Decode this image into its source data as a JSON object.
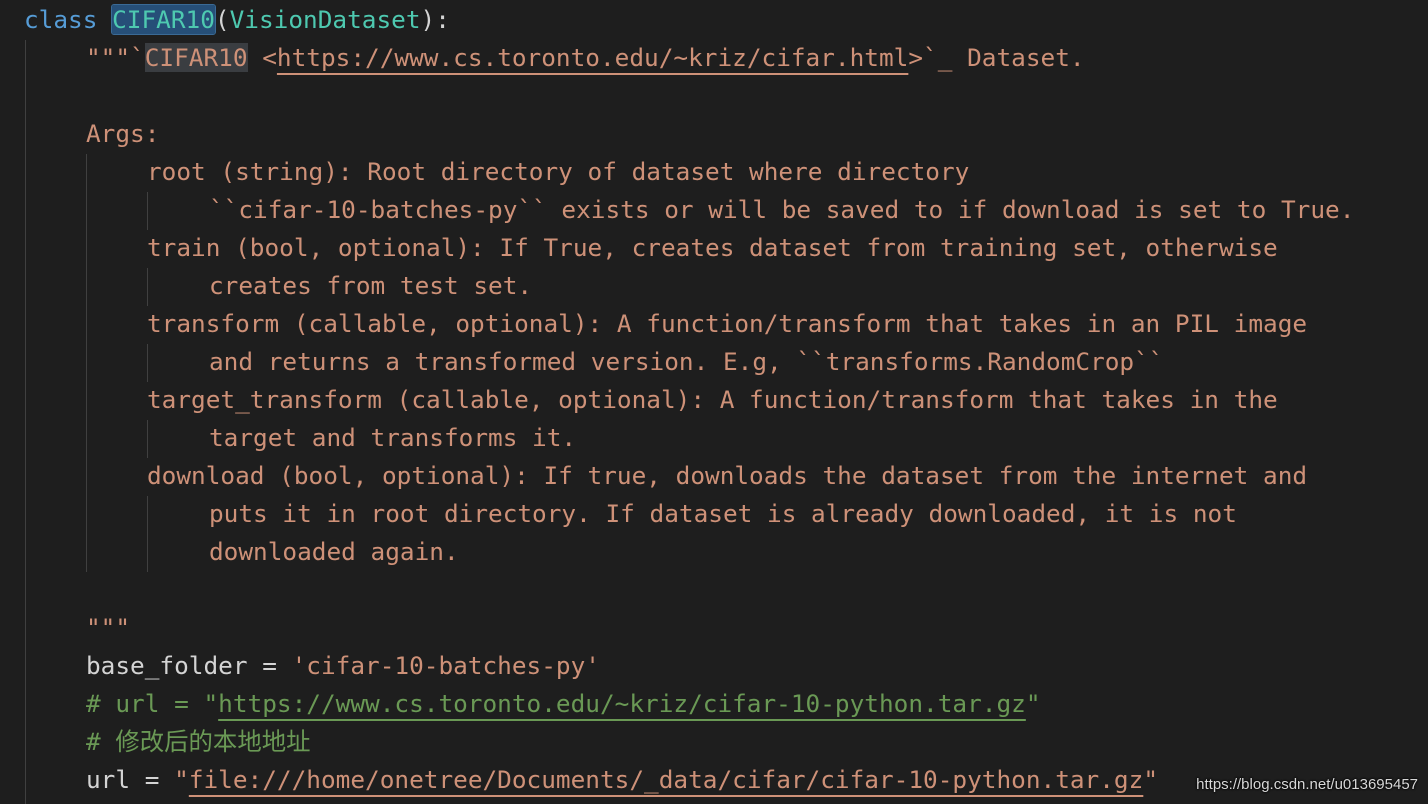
{
  "editor": {
    "class_keyword": "class",
    "class_name": "CIFAR10",
    "paren_open": "(",
    "base_class": "VisionDataset",
    "paren_close": "):",
    "doc_open": "\"\"\"`",
    "doc_title": "CIFAR10",
    "doc_space": " <",
    "doc_link": "https://www.cs.toronto.edu/~kriz/cifar.html",
    "doc_tail": ">`_ Dataset.",
    "args_header": "Args:",
    "arg_root_1": "root (string): Root directory of dataset where directory",
    "arg_root_2": "``cifar-10-batches-py`` exists or will be saved to if download is set to True.",
    "arg_train_1": "train (bool, optional): If True, creates dataset from training set, otherwise",
    "arg_train_2": "creates from test set.",
    "arg_transform_1": "transform (callable, optional): A function/transform that takes in an PIL image",
    "arg_transform_2": "and returns a transformed version. E.g, ``transforms.RandomCrop``",
    "arg_target_1": "target_transform (callable, optional): A function/transform that takes in the",
    "arg_target_2": "target and transforms it.",
    "arg_download_1": "download (bool, optional): If true, downloads the dataset from the internet and",
    "arg_download_2": "puts it in root directory. If dataset is already downloaded, it is not",
    "arg_download_3": "downloaded again.",
    "doc_close": "\"\"\"",
    "base_folder_var": "base_folder",
    "assign": " = ",
    "base_folder_val": "'cifar-10-batches-py'",
    "comment_url_prefix": "# url = \"",
    "comment_url_link": "https://www.cs.toronto.edu/~kriz/cifar-10-python.tar.gz",
    "comment_url_suffix": "\"",
    "comment_local": "# 修改后的本地地址",
    "url_var": "url",
    "url_quote_open": "\"",
    "url_value": "file:///home/onetree/Documents/_data/cifar/cifar-10-python.tar.gz",
    "url_quote_close": "\""
  },
  "watermark": "https://blog.csdn.net/u013695457",
  "colors": {
    "background": "#1e1e1e",
    "keyword": "#569cd6",
    "class_name": "#4ec9b0",
    "string": "#ce9178",
    "comment": "#6a9955",
    "plain": "#d4d4d4"
  }
}
